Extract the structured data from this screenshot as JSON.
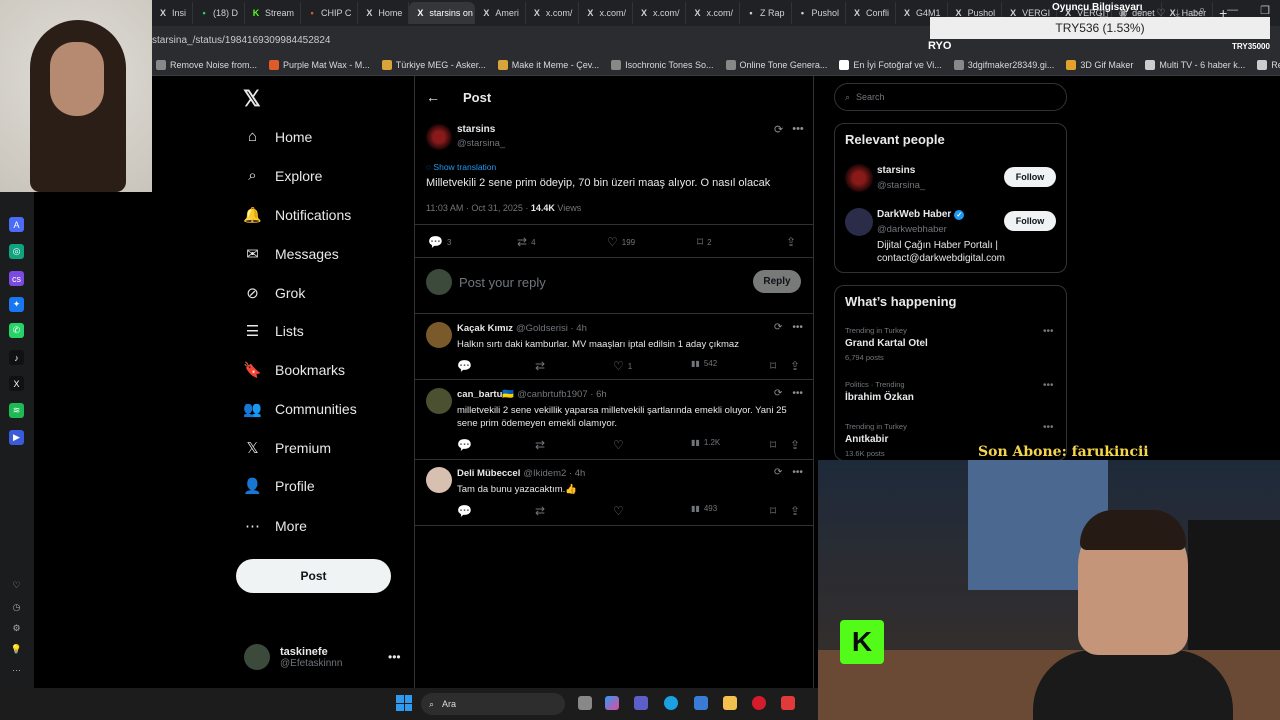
{
  "browser": {
    "tabs": [
      {
        "label": "Insi",
        "icon": "x-icon"
      },
      {
        "label": "(18) D",
        "icon": "chat-icon"
      },
      {
        "label": "Stream",
        "icon": "kick-icon"
      },
      {
        "label": "CHIP C",
        "icon": "chip-icon"
      },
      {
        "label": "Home",
        "icon": "x-icon"
      },
      {
        "label": "starsins on X",
        "icon": "x-icon",
        "active": true
      },
      {
        "label": "Ameri",
        "icon": "x-icon"
      },
      {
        "label": "x.com/",
        "icon": "x-icon"
      },
      {
        "label": "x.com/",
        "icon": "x-icon"
      },
      {
        "label": "x.com/",
        "icon": "x-icon"
      },
      {
        "label": "x.com/",
        "icon": "x-icon"
      },
      {
        "label": "Z Rap",
        "icon": "z-icon"
      },
      {
        "label": "Pushol",
        "icon": "p-icon"
      },
      {
        "label": "Confli",
        "icon": "x-icon"
      },
      {
        "label": "G4M1",
        "icon": "x-icon"
      },
      {
        "label": "Pushol",
        "icon": "x-icon"
      },
      {
        "label": "VERGI",
        "icon": "x-icon"
      },
      {
        "label": "VERGI",
        "icon": "x-icon"
      },
      {
        "label": "denet",
        "icon": "x-icon"
      },
      {
        "label": "Haber",
        "icon": "x-icon"
      }
    ],
    "url": "starsina_/status/1984169309984452824",
    "bookmarks": [
      {
        "label": "Remove Noise from...",
        "color": "#888888"
      },
      {
        "label": "Purple Mat Wax - M...",
        "color": "#e05a2a"
      },
      {
        "label": "Türkiye MEG - Asker...",
        "color": "#d9a43a"
      },
      {
        "label": "Make it Meme - Çev...",
        "color": "#d9a43a"
      },
      {
        "label": "Isochronic Tones So...",
        "color": "#888888"
      },
      {
        "label": "Online Tone Genera...",
        "color": "#888888"
      },
      {
        "label": "En İyi Fotoğraf ve Vi...",
        "color": "#ffffff"
      },
      {
        "label": "3dgifmaker28349.gi...",
        "color": "#888888"
      },
      {
        "label": "3D Gif Maker",
        "color": "#e0a22a"
      },
      {
        "label": "Multi TV - 6 haber k...",
        "color": "#cccccc"
      },
      {
        "label": "Rehber: Windows 1...",
        "color": "#cccccc"
      }
    ]
  },
  "nav": {
    "items": [
      {
        "label": "Home",
        "icon": "home-icon",
        "glyph": "⌂"
      },
      {
        "label": "Explore",
        "icon": "search-icon",
        "glyph": "⌕"
      },
      {
        "label": "Notifications",
        "icon": "bell-icon",
        "glyph": "🔔"
      },
      {
        "label": "Messages",
        "icon": "mail-icon",
        "glyph": "✉"
      },
      {
        "label": "Grok",
        "icon": "grok-icon",
        "glyph": "⊘"
      },
      {
        "label": "Lists",
        "icon": "list-icon",
        "glyph": "☰"
      },
      {
        "label": "Bookmarks",
        "icon": "bookmark-icon",
        "glyph": "🔖"
      },
      {
        "label": "Communities",
        "icon": "communities-icon",
        "glyph": "👥"
      },
      {
        "label": "Premium",
        "icon": "x-premium-icon",
        "glyph": "𝕏"
      },
      {
        "label": "Profile",
        "icon": "profile-icon",
        "glyph": "👤"
      },
      {
        "label": "More",
        "icon": "more-icon",
        "glyph": "⋯"
      }
    ],
    "post_label": "Post",
    "user_name": "taskinefe",
    "user_handle": "@Efetaskinnn"
  },
  "post": {
    "header_title": "Post",
    "author_name": "starsins",
    "author_handle": "@starsina_",
    "translate_label": "Show translation",
    "text": "Milletvekili 2 sene prim ödeyip, 70 bin üzeri maaş alıyor. O nasıl olacak",
    "time": "11:03 AM · Oct 31, 2025 · ",
    "views_count": "14.4K",
    "views_label": " Views",
    "replies": "3",
    "reposts": "4",
    "likes": "199",
    "bookmarks": "2",
    "reply_placeholder": "Post your reply",
    "reply_button": "Reply"
  },
  "replies": [
    {
      "name": "Kaçak Kımız",
      "handle": "@Goldserisi · 4h",
      "text": "Halkın sırtı daki kamburlar. MV maaşları iptal edilsin 1 aday çıkmaz",
      "likes": "1",
      "views": "542",
      "avatar_color": "#7a5a2a"
    },
    {
      "name": "can_bartu🇺🇦",
      "handle": "@canbrtufb1907 · 6h",
      "text": "milletvekili 2 sene vekillik yaparsa milletvekili şartlarında emekli oluyor. Yani 25 sene prim ödemeyen emekli olamıyor.",
      "likes": "",
      "views": "1.2K",
      "avatar_color": "#4a5030"
    },
    {
      "name": "Deli Mübeccel",
      "handle": "@Ikidem2 · 4h",
      "text": "Tam da bunu yazacaktım.👍",
      "likes": "",
      "views": "493",
      "avatar_color": "#d8c0b0"
    }
  ],
  "sidebar": {
    "search_placeholder": "Search",
    "relevant_title": "Relevant people",
    "people": [
      {
        "name": "starsins",
        "handle": "@starsina_",
        "bio": "",
        "follow": "Follow"
      },
      {
        "name": "DarkWeb Haber",
        "handle": "@darkwebhaber",
        "bio_1": "Dijital Çağın Haber Portalı |",
        "bio_2": "contact@darkwebdigital.com",
        "follow": "Follow"
      }
    ],
    "trends_title": "What’s happening",
    "trends": [
      {
        "meta": "Trending in Turkey",
        "title": "Grand Kartal Otel",
        "posts": "6,794 posts"
      },
      {
        "meta": "Politics · Trending",
        "title": "İbrahim Özkan",
        "posts": ""
      },
      {
        "meta": "Trending in Turkey",
        "title": "Anıtkabir",
        "posts": "13.6K posts"
      }
    ]
  },
  "overlay": {
    "ticker_top": "Oyuncu Bilgisayarı",
    "ticker": "TRY536 (1.53%)",
    "ryo": "RYO",
    "try_right": "TRY35000",
    "sub_label": "Son Abone: farukincii"
  },
  "taskbar": {
    "search_label": "Ara"
  },
  "colors": {
    "accent": "#1d9bf0",
    "kick": "#53fc18",
    "background": "#000000"
  }
}
